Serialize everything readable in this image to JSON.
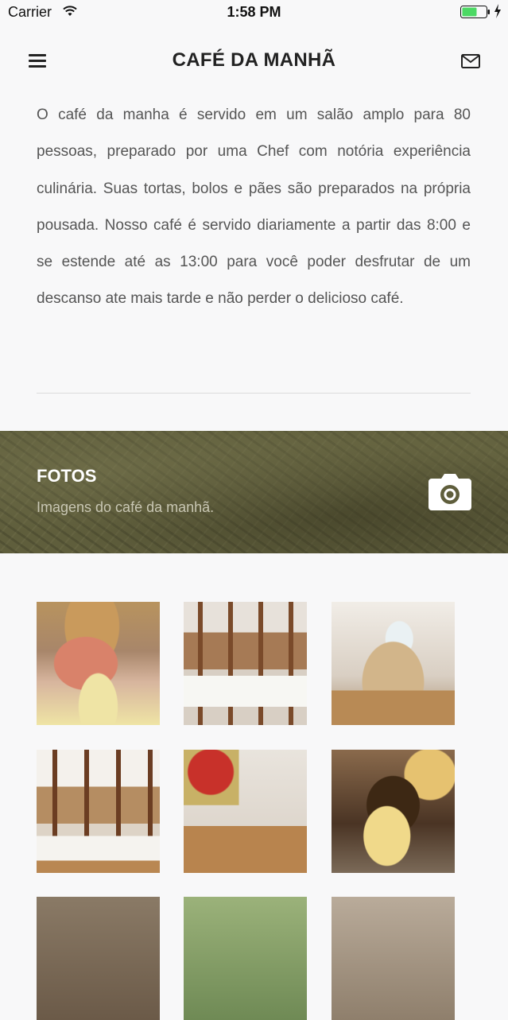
{
  "status_bar": {
    "carrier": "Carrier",
    "time": "1:58 PM",
    "battery_color": "#4cd964"
  },
  "navbar": {
    "title": "CAFÉ DA MANHÃ",
    "left_icon": "hamburger-menu-icon",
    "right_icon": "mail-icon"
  },
  "description": "O café da manha é servido em um salão amplo para 80 pessoas, preparado por uma Chef com notória experiência culinária. Suas tortas, bolos e pães são preparados na própria pousada. Nosso café é servido diariamente a partir das 8:00 e se estende até as 13:00 para você poder desfrutar de um descanso ate mais tarde e não perder o delicioso café.",
  "photos_section": {
    "title": "FOTOS",
    "subtitle": "Imagens do café da manhã.",
    "icon": "camera-icon"
  },
  "gallery": {
    "photos": [
      "photo-1",
      "photo-2",
      "photo-3",
      "photo-4",
      "photo-5",
      "photo-6",
      "photo-7",
      "photo-8",
      "photo-9"
    ]
  }
}
